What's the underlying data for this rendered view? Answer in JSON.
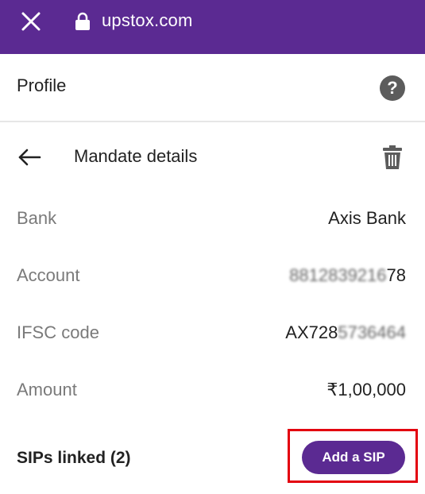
{
  "browser": {
    "url": "upstox.com",
    "icons": {
      "close": "close-icon",
      "lock": "lock-icon"
    },
    "colors": {
      "bar": "#5b2a92"
    }
  },
  "profile": {
    "title": "Profile",
    "help_icon": "help-icon",
    "help_glyph": "?"
  },
  "mandate": {
    "title": "Mandate details",
    "back_icon": "arrow-left-icon",
    "delete_icon": "trash-icon"
  },
  "details": [
    {
      "label": "Bank",
      "value": "Axis Bank"
    },
    {
      "label": "Account",
      "value_masked": "8812839216",
      "value_visible": "78"
    },
    {
      "label": "IFSC code",
      "value_visible": "AX728",
      "value_masked": "5736464"
    },
    {
      "label": "Amount",
      "value": "₹1,00,000"
    }
  ],
  "sips": {
    "label": "SIPs linked (2)",
    "button_label": "Add a SIP",
    "button_color": "#5b2a92",
    "highlight_color": "#e3000f"
  }
}
